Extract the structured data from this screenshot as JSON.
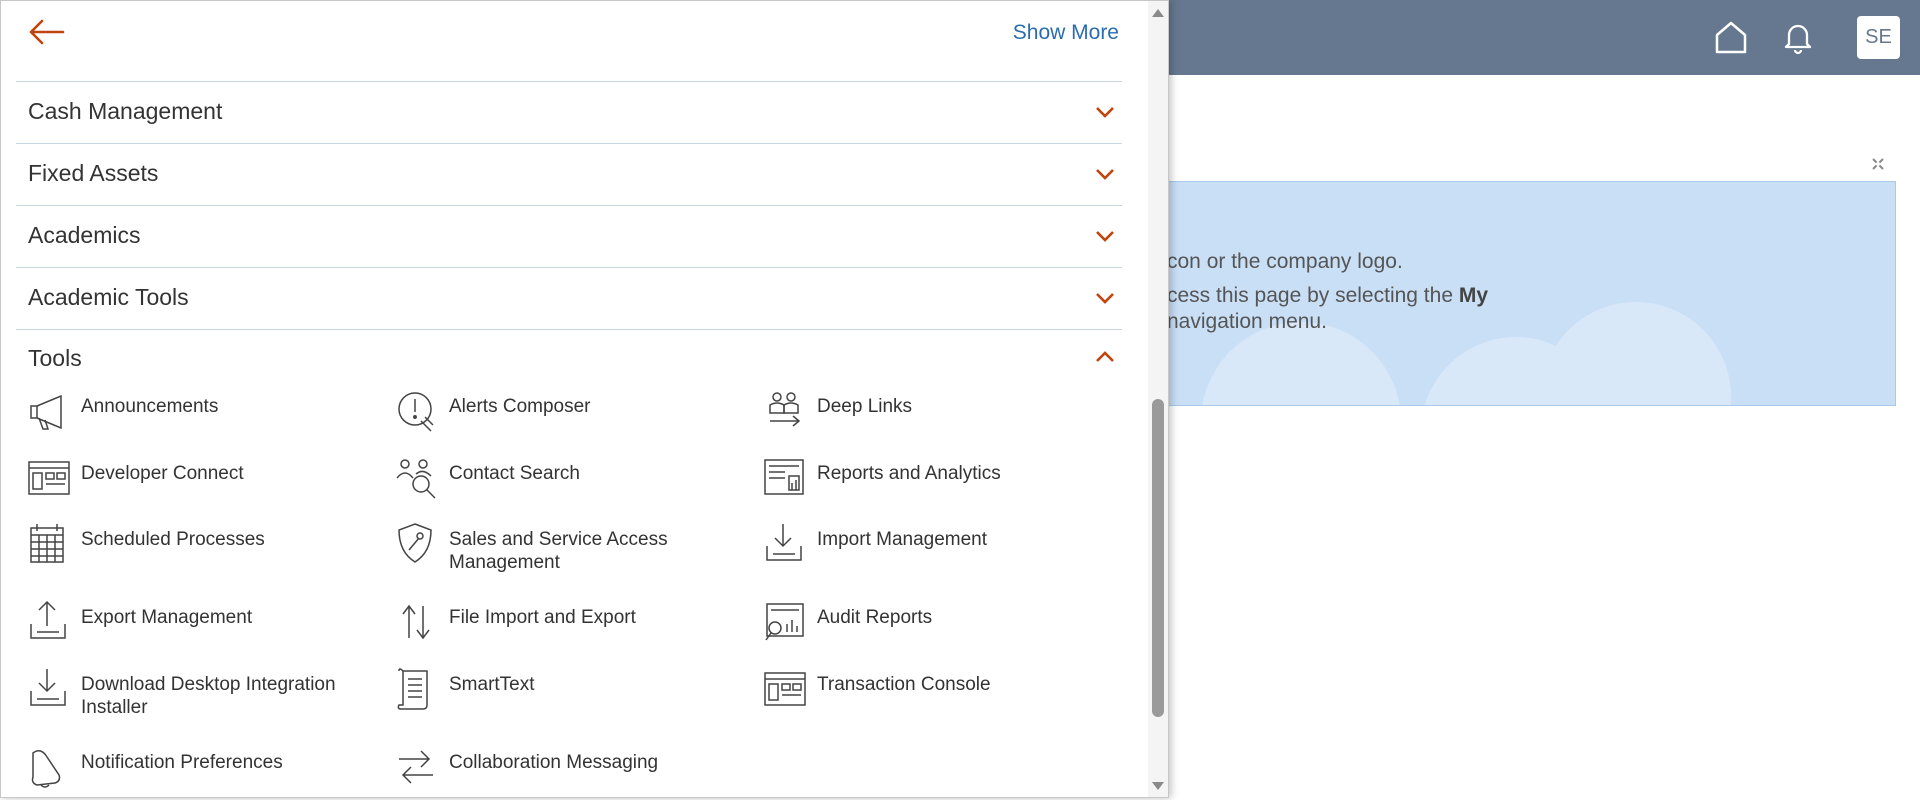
{
  "header": {
    "avatar_initials": "SE",
    "home_icon": "home-icon",
    "bell_icon": "bell-icon",
    "background_color": "#66788f"
  },
  "banner": {
    "line1": "con or the company logo.",
    "line2_text": "cess this page by selecting the ",
    "line2_bold": "My",
    "line3": "navigation menu.",
    "background_color": "#c9dff6"
  },
  "navigator": {
    "show_more": "Show More",
    "accent_color": "#c1440e",
    "sections": [
      {
        "label": "Cash Management",
        "expanded": false
      },
      {
        "label": "Fixed Assets",
        "expanded": false
      },
      {
        "label": "Academics",
        "expanded": false
      },
      {
        "label": "Academic Tools",
        "expanded": false
      }
    ],
    "tools": {
      "label": "Tools",
      "expanded": true,
      "items": [
        {
          "label": "Announcements",
          "icon": "megaphone-icon"
        },
        {
          "label": "Alerts Composer",
          "icon": "alert-wrench-icon"
        },
        {
          "label": "Deep Links",
          "icon": "people-link-icon"
        },
        {
          "label": "Developer Connect",
          "icon": "window-grid-icon"
        },
        {
          "label": "Contact Search",
          "icon": "people-search-icon"
        },
        {
          "label": "Reports and Analytics",
          "icon": "report-chart-icon"
        },
        {
          "label": "Scheduled Processes",
          "icon": "calendar-icon"
        },
        {
          "label": "Sales and Service Access Management",
          "icon": "shield-wrench-icon"
        },
        {
          "label": "Import Management",
          "icon": "import-tray-icon"
        },
        {
          "label": "Export Management",
          "icon": "export-tray-icon"
        },
        {
          "label": "File Import and Export",
          "icon": "up-down-arrows-icon"
        },
        {
          "label": "Audit Reports",
          "icon": "audit-report-icon"
        },
        {
          "label": "Download Desktop Integration Installer",
          "icon": "download-tray-icon"
        },
        {
          "label": "SmartText",
          "icon": "scroll-document-icon"
        },
        {
          "label": "Transaction Console",
          "icon": "console-window-icon"
        },
        {
          "label": "Notification Preferences",
          "icon": "bell-icon"
        },
        {
          "label": "Collaboration Messaging",
          "icon": "exchange-arrows-icon"
        }
      ]
    }
  }
}
